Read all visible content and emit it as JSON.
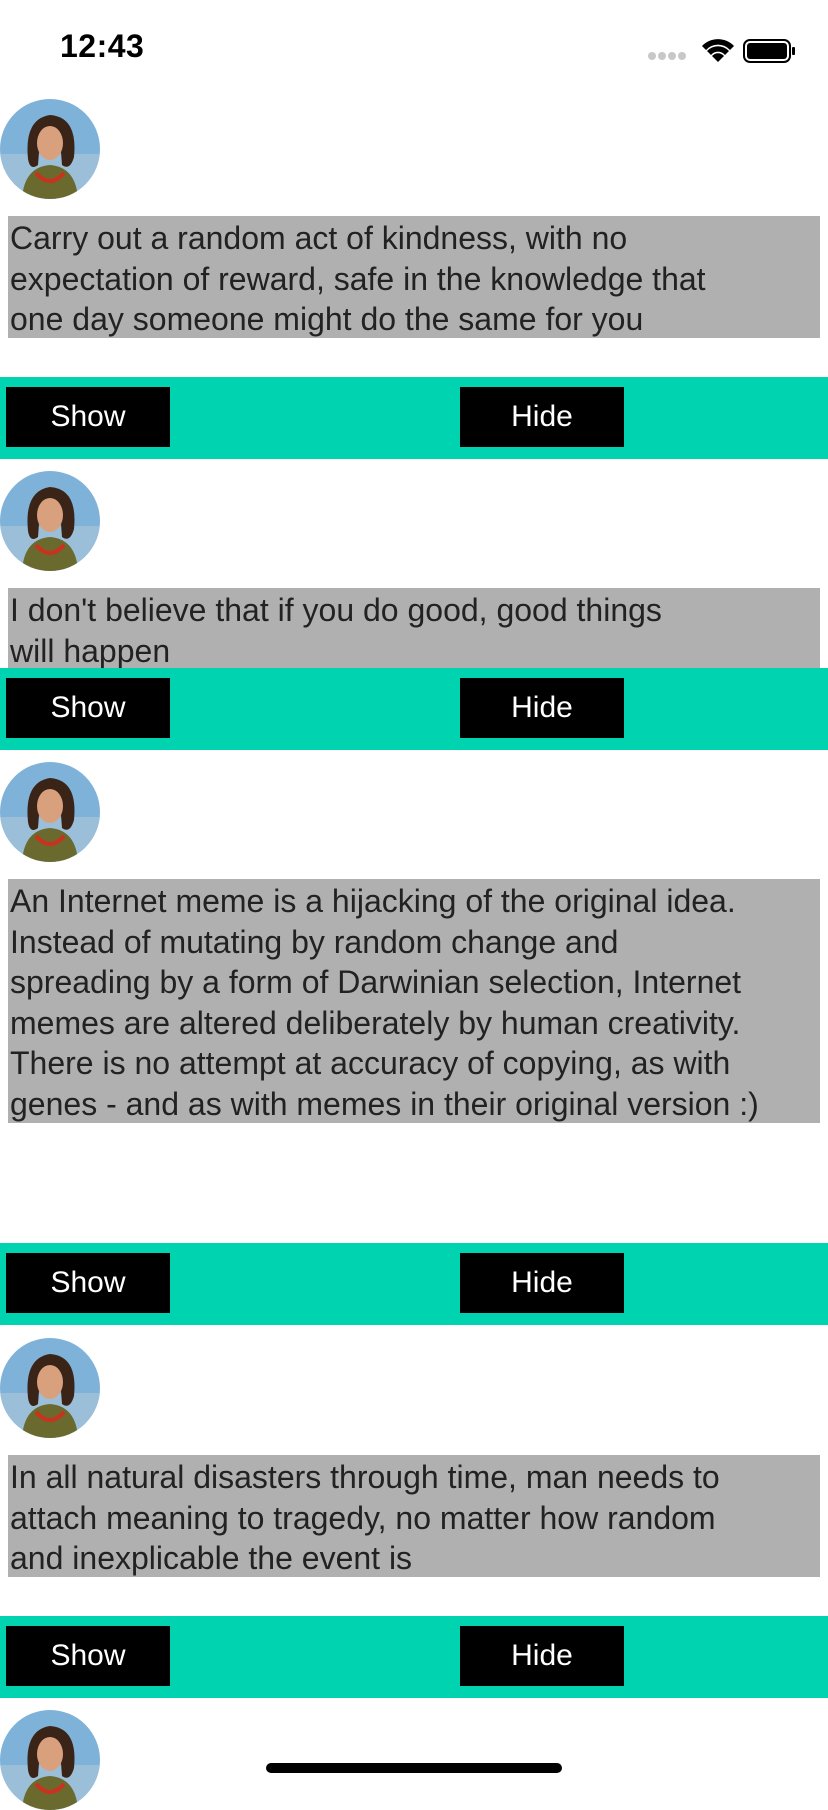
{
  "status_bar": {
    "time": "12:43"
  },
  "colors": {
    "button_bar": "#00d3b0",
    "quote_background": "#b0b0b0",
    "button_background": "#000000",
    "button_text": "#ffffff"
  },
  "feed": {
    "items": [
      {
        "quote": "Carry out a random act of kindness, with no\nexpectation of reward, safe in the knowledge that\none day someone might do the same for you",
        "show_label": "Show",
        "hide_label": "Hide"
      },
      {
        "quote": "I don't believe that if you do good, good things\nwill happen",
        "show_label": "Show",
        "hide_label": "Hide"
      },
      {
        "quote": "An Internet meme is a hijacking of the original idea.\nInstead of mutating by random change and\nspreading by a form of Darwinian selection, Internet\nmemes are altered deliberately by human creativity.\nThere is no attempt at accuracy of copying, as with\ngenes - and as with memes in their original version :)",
        "show_label": "Show",
        "hide_label": "Hide"
      },
      {
        "quote": "In all natural disasters through time, man needs to\nattach meaning to tragedy, no matter how random\nand inexplicable the event is",
        "show_label": "Show",
        "hide_label": "Hide"
      }
    ]
  }
}
